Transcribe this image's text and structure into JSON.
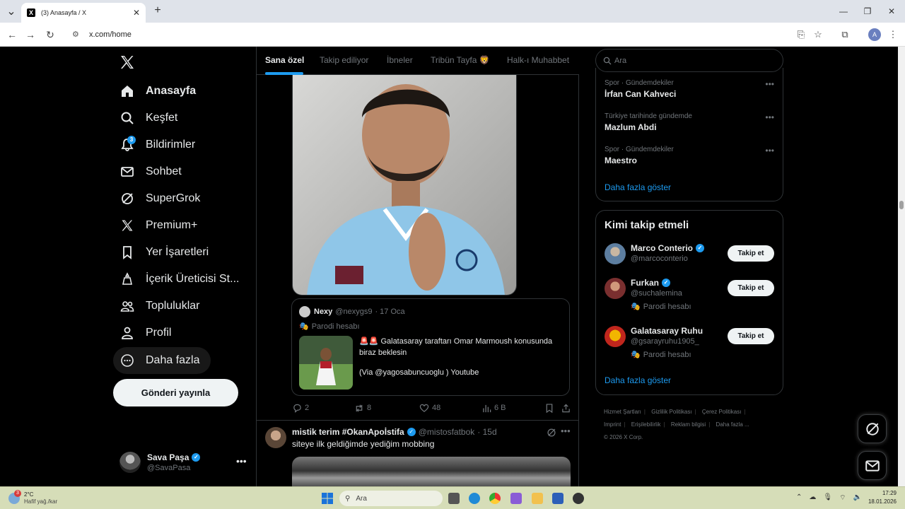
{
  "browser": {
    "tab_title": "(3) Anasayfa / X",
    "url": "x.com/home",
    "profile_initial": "A"
  },
  "nav": {
    "items": [
      {
        "label": "Anasayfa",
        "icon": "home-icon",
        "active": true
      },
      {
        "label": "Keşfet",
        "icon": "search-icon"
      },
      {
        "label": "Bildirimler",
        "icon": "bell-icon",
        "badge": "3"
      },
      {
        "label": "Sohbet",
        "icon": "mail-icon"
      },
      {
        "label": "SuperGrok",
        "icon": "grok-icon"
      },
      {
        "label": "Premium+",
        "icon": "x-icon"
      },
      {
        "label": "Yer İşaretleri",
        "icon": "bookmark-icon"
      },
      {
        "label": "İçerik Üreticisi St...",
        "icon": "studio-icon"
      },
      {
        "label": "Topluluklar",
        "icon": "communities-icon"
      },
      {
        "label": "Profil",
        "icon": "profile-icon"
      },
      {
        "label": "Daha fazla",
        "icon": "more-circle-icon"
      }
    ],
    "post_button": "Gönderi yayınla",
    "account": {
      "name": "Sava Paşa",
      "handle": "@SavaPasa"
    }
  },
  "feed": {
    "tabs": [
      "Sana özel",
      "Takip ediliyor",
      "İbneler",
      "Tribün Tayfa 🦁",
      "Halk-ı Muhabbet"
    ],
    "tweet1": {
      "quote": {
        "name": "Nexy",
        "handle": "@nexygs9",
        "date": "· 17 Oca",
        "parody": "Parodi hesabı",
        "text": "🚨🚨 Galatasaray taraftarı Omar Marmoush konusunda biraz beklesin",
        "via": "(Via @yagosabuncuoglu ) Youtube"
      },
      "actions": {
        "replies": "2",
        "reposts": "8",
        "likes": "48",
        "views": "6 B"
      }
    },
    "tweet2": {
      "name": "mistik terim #OkanApoİstifa",
      "handle": "@mistosfatbok",
      "date": "· 15d",
      "text": "siteye ilk geldiğimde yediğim mobbing"
    }
  },
  "sidebar": {
    "search_placeholder": "Ara",
    "trends": [
      {
        "context": "Spor · Gündemdekiler",
        "title": "İrfan Can Kahveci"
      },
      {
        "context": "Türkiye tarihinde gündemde",
        "title": "Mazlum Abdi"
      },
      {
        "context": "Spor · Gündemdekiler",
        "title": "Maestro"
      }
    ],
    "trends_show_more": "Daha fazla göster",
    "who_to_follow_title": "Kimi takip etmeli",
    "who_to_follow": [
      {
        "name": "Marco Conterio",
        "handle": "@marcoconterio",
        "parody": "",
        "button": "Takip et"
      },
      {
        "name": "Furkan",
        "handle": "@suchalemina",
        "parody": "Parodi hesabı",
        "button": "Takip et"
      },
      {
        "name": "Galatasaray Ruhu",
        "handle": "@gsarayruhu1905_",
        "parody": "Parodi hesabı",
        "button": "Takip et"
      }
    ],
    "who_show_more": "Daha fazla göster",
    "footer": [
      "Hizmet Şartları",
      "Gizlilik Politikası",
      "Çerez Politikası",
      "Imprint",
      "Erişilebilirlik",
      "Reklam bilgisi",
      "Daha fazla ...",
      "© 2026 X Corp."
    ]
  },
  "taskbar": {
    "weather_temp": "2°C",
    "weather_desc": "Hafif yağ./kar",
    "weather_badge": "3",
    "search": "Ara",
    "time": "17:29",
    "date": "18.01.2026"
  },
  "colors": {
    "accent": "#1d9bf0",
    "background": "#000000",
    "border": "#2f3336"
  }
}
